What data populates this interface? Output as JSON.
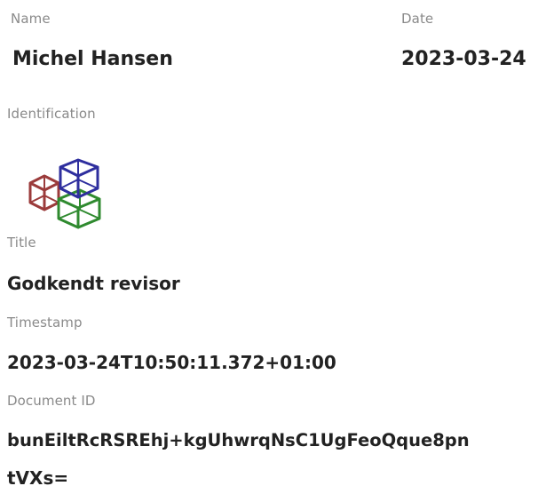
{
  "signer": {
    "name_label": "Name",
    "name_value": "Michel Hansen",
    "date_label": "Date",
    "date_value": "2023-03-24"
  },
  "identification": {
    "label": "Identification",
    "logo_icon": "interlocking-cubes-logo",
    "logo_colors": [
      "#9b3b3b",
      "#2e2e9e",
      "#2f8a2f"
    ]
  },
  "title": {
    "label": "Title",
    "value": "Godkendt revisor"
  },
  "timestamp": {
    "label": "Timestamp",
    "value": "2023-03-24T10:50:11.372+01:00"
  },
  "document_id": {
    "label": "Document ID",
    "value_line1": "bunEiltRcRSREhj+kgUhwrqNsC1UgFeoQque8pn",
    "value_line2": "tVXs="
  }
}
